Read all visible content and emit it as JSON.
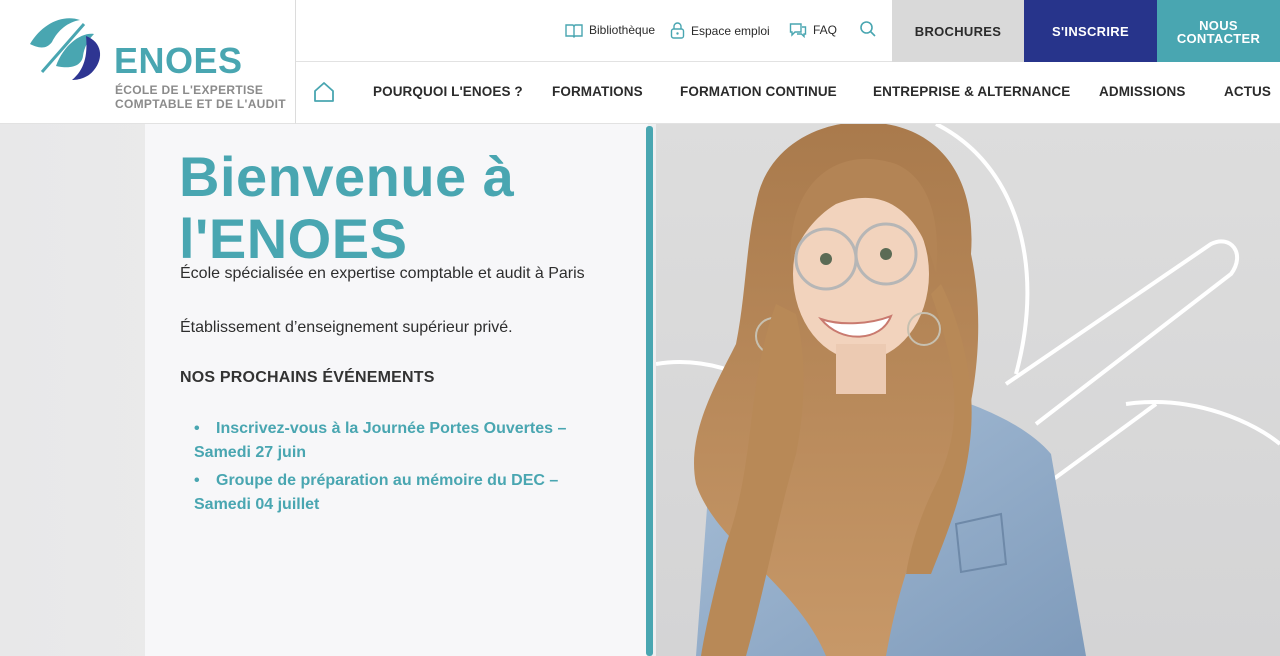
{
  "brand": {
    "name": "ENOES",
    "subtitle_line1": "ÉCOLE DE L'EXPERTISE",
    "subtitle_line2": "COMPTABLE ET DE L'AUDIT",
    "colors": {
      "teal": "#49a6b1",
      "navy": "#27348b",
      "grey_button": "#d9d9d9"
    }
  },
  "utility_links": [
    {
      "label": "Bibliothèque",
      "icon": "book-icon"
    },
    {
      "label": "Espace emploi",
      "icon": "lock-icon"
    },
    {
      "label": "FAQ",
      "icon": "chat-icon"
    }
  ],
  "search": {
    "icon": "search-icon"
  },
  "cta_buttons": {
    "brochures": "BROCHURES",
    "inscrire": "S'INSCRIRE",
    "contact_line1": "NOUS",
    "contact_line2": "CONTACTER"
  },
  "nav": {
    "home_icon": "home-icon",
    "items": [
      "POURQUOI L'ENOES ?",
      "FORMATIONS",
      "FORMATION CONTINUE",
      "ENTREPRISE & ALTERNANCE",
      "ADMISSIONS",
      "ACTUS"
    ]
  },
  "hero": {
    "title_line1": "Bienvenue à",
    "title_line2": "l'ENOES",
    "subtitle": "École spécialisée en expertise comptable et audit à Paris",
    "description": "Établissement d’enseignement supérieur privé.",
    "events_heading": "NOS PROCHAINS ÉVÉNEMENTS",
    "bullet": "•",
    "events": [
      "Inscrivez-vous à la Journée Portes Ouvertes – Samedi 27 juin",
      "Groupe de préparation au mémoire du DEC – Samedi 04 juillet"
    ]
  }
}
